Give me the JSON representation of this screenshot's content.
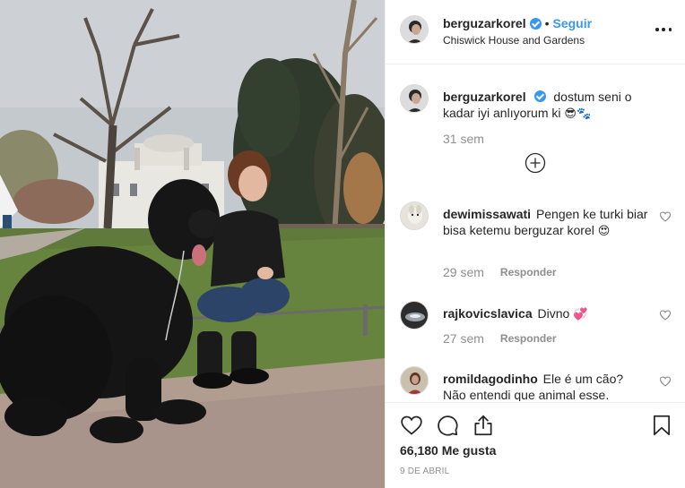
{
  "post": {
    "photo_alt": "",
    "header": {
      "username": "berguzarkorel",
      "separator": "•",
      "follow_label": "Seguir",
      "location": "Chiswick House and Gardens"
    },
    "caption": {
      "username": "berguzarkorel",
      "text": "dostum seni o kadar iyi anlıyorum ki",
      "emoji": "😎🐾",
      "time": "31 sem"
    },
    "comments": [
      {
        "username": "dewimissawati",
        "text": "Pengen ke turki biar bisa ketemu berguzar korel",
        "emoji": "😍",
        "time": "29 sem",
        "reply_label": "Responder"
      },
      {
        "username": "rajkovicslavica",
        "text": "Divno",
        "emoji": "💞",
        "time": "27 sem",
        "reply_label": "Responder"
      },
      {
        "username": "romildagodinho",
        "text": "Ele é um cão? Não entendi que animal esse.",
        "emoji": "",
        "time": "",
        "reply_label": ""
      }
    ],
    "likes_count": "66,180",
    "likes_label": "Me gusta",
    "date": "9 DE ABRIL",
    "icons": {
      "more": "more-options-icon",
      "like": "heart-icon",
      "comment": "comment-bubble-icon",
      "share": "share-icon",
      "save": "bookmark-icon",
      "add_comments": "plus-circle-icon",
      "verified": "verified-badge-icon"
    },
    "colors": {
      "accent": "#3897f0",
      "text": "#262626",
      "muted": "#8e8e8e",
      "divider": "#efefef"
    }
  }
}
